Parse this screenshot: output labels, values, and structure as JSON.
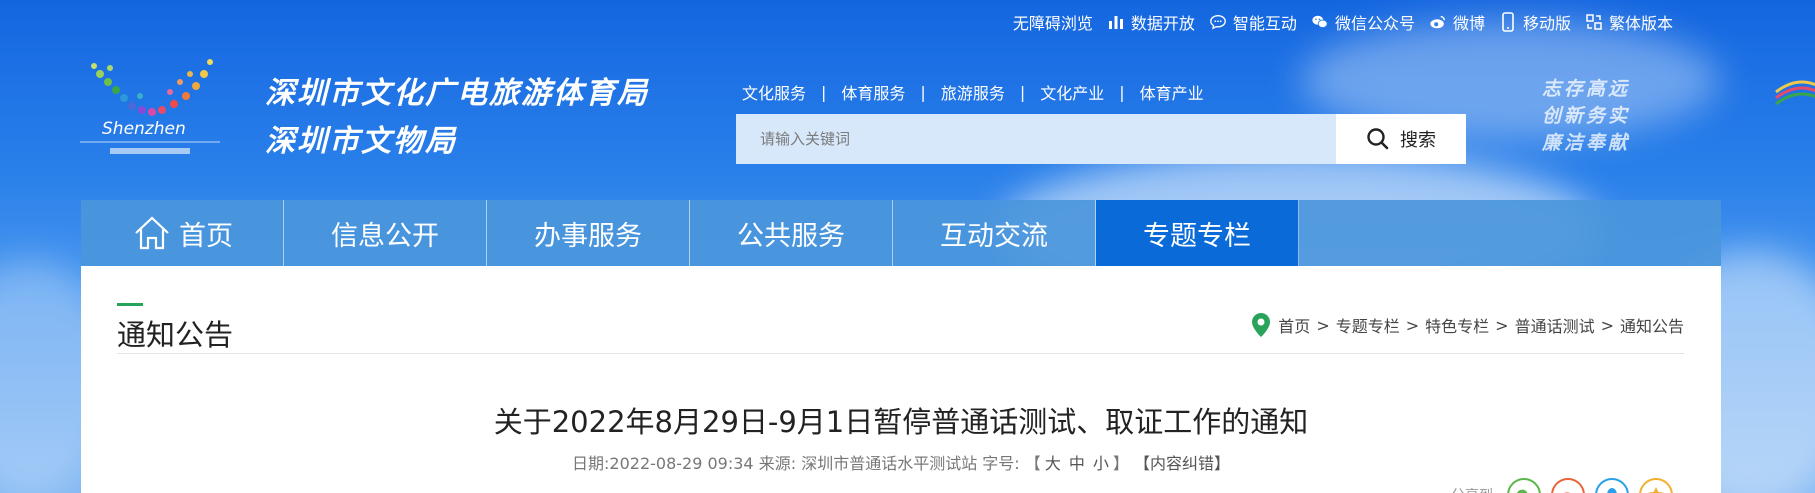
{
  "topbar": {
    "items": [
      {
        "label": "无障碍浏览",
        "icon": "none"
      },
      {
        "label": "数据开放",
        "icon": "bar-chart-icon"
      },
      {
        "label": "智能互动",
        "icon": "chat-bubble-icon"
      },
      {
        "label": "微信公众号",
        "icon": "wechat-icon"
      },
      {
        "label": "微博",
        "icon": "weibo-icon"
      },
      {
        "label": "移动版",
        "icon": "mobile-icon"
      },
      {
        "label": "繁体版本",
        "icon": "traditional-chinese-icon"
      }
    ]
  },
  "header": {
    "logo_text": "Shenzhen",
    "org_line1": "深圳市文化广电旅游体育局",
    "org_line2": "深圳市文物局",
    "slogan_lines": [
      "志存高远",
      "创新务实",
      "廉洁奉献"
    ]
  },
  "service_nav": [
    "文化服务",
    "体育服务",
    "旅游服务",
    "文化产业",
    "体育产业"
  ],
  "search": {
    "placeholder": "请输入关键词",
    "button_label": "搜索"
  },
  "main_nav": [
    {
      "label": "首页",
      "active": false
    },
    {
      "label": "信息公开",
      "active": false
    },
    {
      "label": "办事服务",
      "active": false
    },
    {
      "label": "公共服务",
      "active": false
    },
    {
      "label": "互动交流",
      "active": false
    },
    {
      "label": "专题专栏",
      "active": true
    }
  ],
  "section": {
    "title": "通知公告",
    "breadcrumb": [
      "首页",
      "专题专栏",
      "特色专栏",
      "普通话测试",
      "通知公告"
    ]
  },
  "article": {
    "title": "关于2022年8月29日-9月1日暂停普通话测试、取证工作的通知",
    "date_label": "日期:",
    "date": "2022-08-29 09:34",
    "source_label": "来源:",
    "source": "深圳市普通话水平测试站",
    "font_size_label": "字号:",
    "font_sizes": [
      "大",
      "中",
      "小"
    ],
    "correction": "【内容纠错】",
    "share_label": "分享到"
  },
  "colors": {
    "nav_bg": "#4a96dc",
    "nav_active": "#0a6bd8",
    "accent_green": "#2aa35a"
  }
}
